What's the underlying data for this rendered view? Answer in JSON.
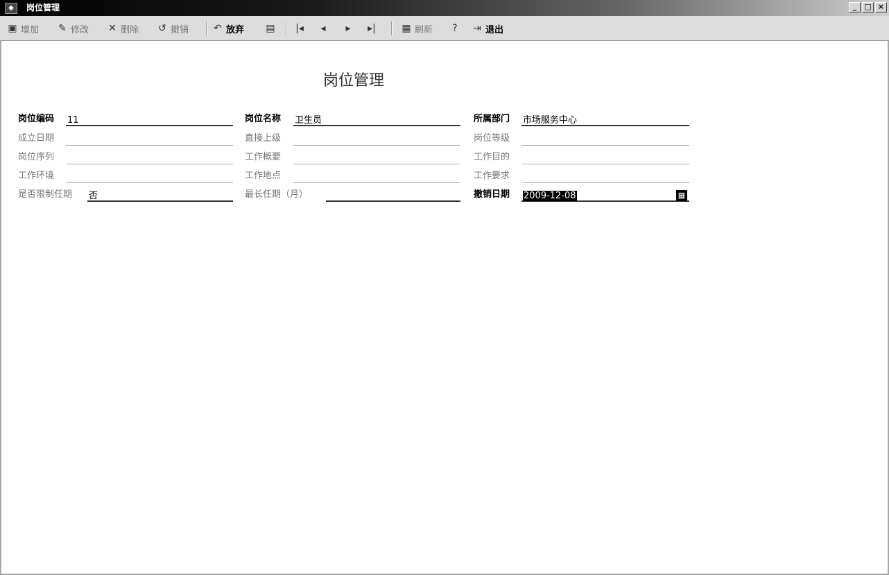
{
  "window": {
    "title": "岗位管理",
    "minimize": "_",
    "maximize": "□",
    "close": "×"
  },
  "toolbar": {
    "add": "增加",
    "edit": "修改",
    "delete": "删除",
    "undo": "撤销",
    "discard": "放弃",
    "first": "",
    "prev": "",
    "next": "",
    "last": "",
    "refresh": "刷新",
    "exit": "退出"
  },
  "icons": {
    "add": "▣",
    "edit": "✎",
    "delete": "✕",
    "undo": "↺",
    "discard": "↶",
    "save": "▤",
    "first": "|◂",
    "prev": "◂",
    "next": "▸",
    "last": "▸|",
    "refresh": "▦",
    "help": "?",
    "exit": "⇥",
    "calendar": "▦"
  },
  "form": {
    "title": "岗位管理",
    "post_code_label": "岗位编码",
    "post_code": "11",
    "post_name_label": "岗位名称",
    "post_name": "卫生员",
    "dept_label": "所属部门",
    "dept": "市场服务中心",
    "setup_date_label": "成立日期",
    "setup_date": "",
    "superior_label": "直接上级",
    "superior": "",
    "grade_label": "岗位等级",
    "grade": "",
    "sequence_label": "岗位序列",
    "sequence": "",
    "summary_label": "工作概要",
    "summary": "",
    "purpose_label": "工作目的",
    "purpose": "",
    "environment_label": "工作环境",
    "environment": "",
    "location_label": "工作地点",
    "location": "",
    "requirement_label": "工作要求",
    "requirement": "",
    "term_limit_label": "是否限制任期",
    "term_limit": "否",
    "max_term_label": "最长任期（月）",
    "max_term": "",
    "revoke_date_label": "撤销日期",
    "revoke_date": "2009-12-08"
  }
}
